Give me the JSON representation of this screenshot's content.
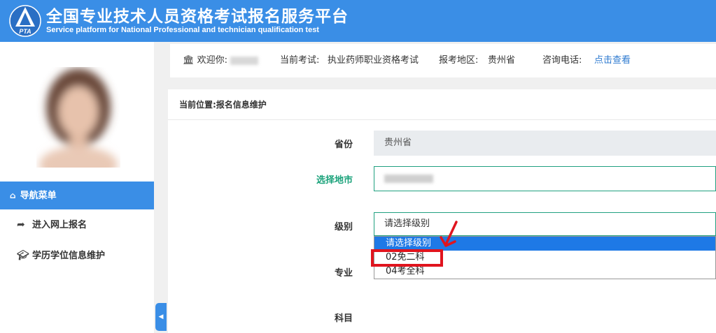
{
  "header": {
    "title_zh": "全国专业技术人员资格考试报名服务平台",
    "title_en": "Service platform for National Professional and technician qualification test",
    "logo_text": "PTA"
  },
  "sidebar": {
    "nav_header": "导航菜单",
    "items": [
      {
        "label": "进入网上报名",
        "icon": "share-arrow-icon"
      },
      {
        "label": "学历学位信息维护",
        "icon": "graduation-cap-icon"
      }
    ]
  },
  "infobar": {
    "welcome": "欢迎你:",
    "current_exam_label": "当前考试:",
    "current_exam": "执业药师职业资格考试",
    "region_label": "报考地区:",
    "region": "贵州省",
    "phone_label": "咨询电话:",
    "phone_link": "点击查看"
  },
  "breadcrumb": "当前位置:报名信息维护",
  "form": {
    "province_label": "省份",
    "province_value": "贵州省",
    "city_label": "选择地市",
    "level_label": "级别",
    "level_value": "请选择级别",
    "major_label": "专业",
    "subject_label": "科目"
  },
  "dropdown": {
    "options": [
      "请选择级别",
      "02免二科",
      "04考全科"
    ]
  },
  "colors": {
    "brand": "#3a8ee6",
    "accent_green": "#1aa27a",
    "highlight": "#e0141e"
  }
}
